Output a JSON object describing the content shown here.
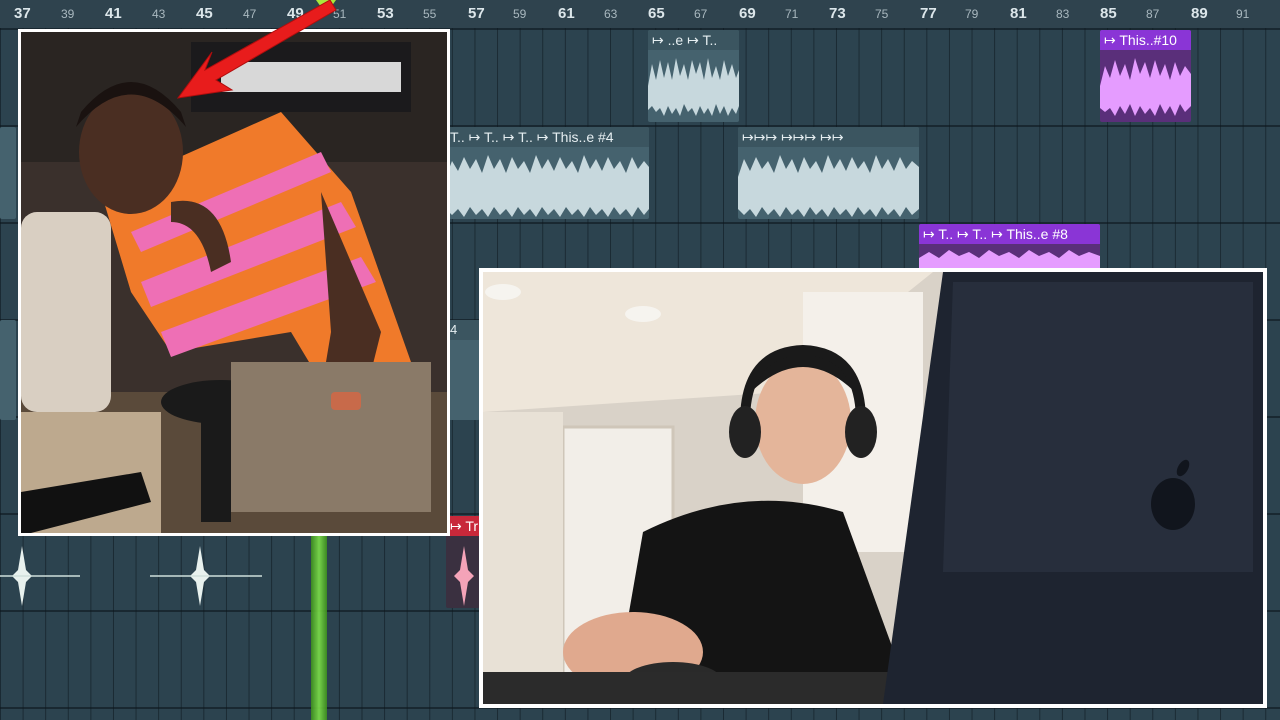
{
  "ruler": {
    "major": [
      "37",
      "41",
      "45",
      "49",
      "53",
      "57",
      "61",
      "65",
      "69",
      "73",
      "77",
      "81",
      "85",
      "89"
    ],
    "minor": [
      "39",
      "43",
      "47",
      "51",
      "55",
      "59",
      "63",
      "67",
      "71",
      "75",
      "79",
      "83",
      "87",
      "91"
    ]
  },
  "clips": {
    "c1_label": "↦ ..e ↦ T..",
    "c2_label": "↦ This..#10",
    "c3_label": "T.. ↦ T.. ↦ T.. ↦ This..e #4",
    "c4_label": "↦↦↦ ↦↦↦ ↦↦",
    "c5_label": "↦ T.. ↦ T.. ↦ This..e #8",
    "c6_label": "↦ Tr",
    "c7_label": "4"
  },
  "colors": {
    "grid": "#2c434f",
    "clip_gray": "#45626e",
    "clip_purple": "#8a35d6",
    "playhead": "#7ee04a",
    "arrow": "#e81c1c"
  },
  "photos": {
    "left": "photo-studio-orange-pink-shirt",
    "right": "photo-producer-headphones-laptop"
  }
}
